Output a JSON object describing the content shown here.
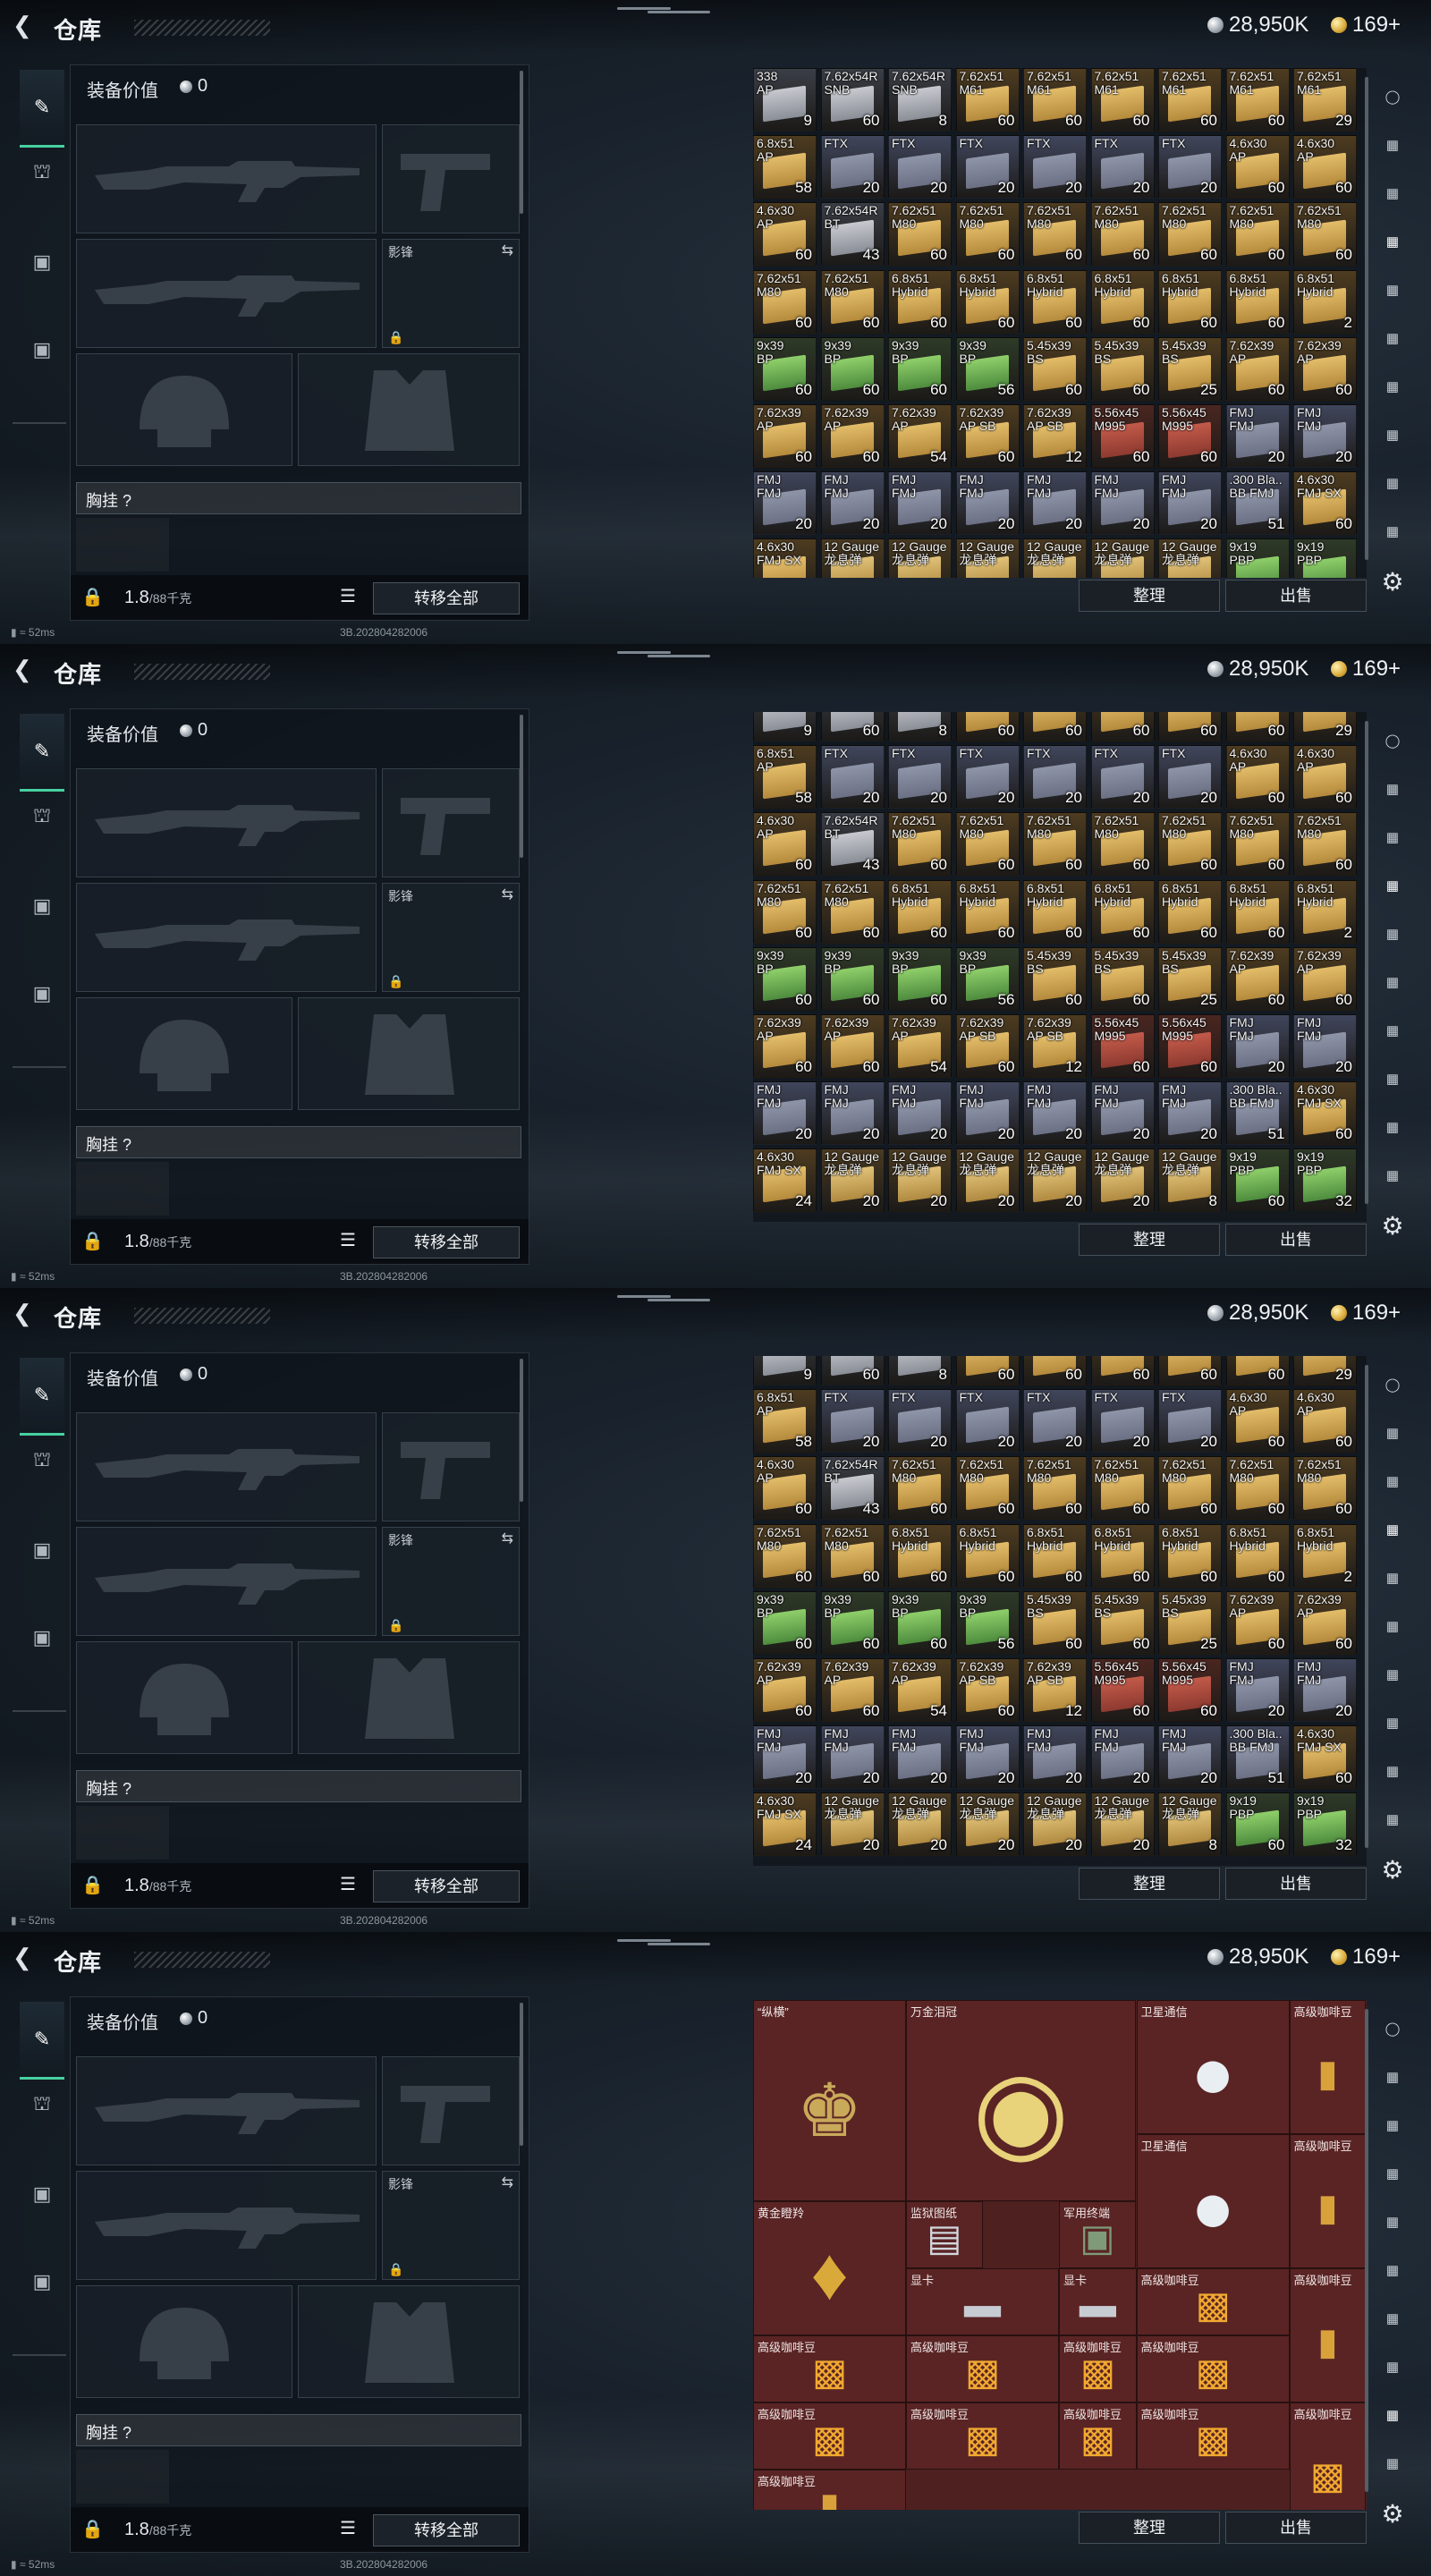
{
  "header": {
    "title": "仓库",
    "silver": "28,950K",
    "gold": "169+"
  },
  "left_tabs": [
    {
      "name": "weapons",
      "icon": "pistol-icon"
    },
    {
      "name": "helmet",
      "icon": "helmet-icon"
    },
    {
      "name": "armor",
      "icon": "vest-icon"
    },
    {
      "name": "bag",
      "icon": "briefcase-icon"
    }
  ],
  "equipment": {
    "title": "装备价值",
    "value": "0",
    "slot_label_secondary": "影锋",
    "chest_label": "胸挂 ?",
    "weight": "1.8",
    "weight_max": "/88千克",
    "transfer_all": "转移全部"
  },
  "actions": {
    "sort": "整理",
    "sell": "出售"
  },
  "status": {
    "ping": "52ms",
    "version": "3B.202804282006"
  },
  "right_bar": [
    "helmet-cat-icon",
    "gun-cat-icon",
    "ammo-cat-icon",
    "lvl-cat-icon",
    "lvl2-cat-icon",
    "lvl3-cat-icon",
    "lvl4-cat-icon",
    "lvl5-cat-icon",
    "lvl6-cat-icon",
    "lvl7-cat-icon"
  ],
  "ammo_rows": [
    [
      [
        "338\nAP",
        "9"
      ],
      [
        "7.62x54R\nSNB",
        "60"
      ],
      [
        "7.62x54R\nSNB",
        "8"
      ],
      [
        "7.62x51\nM61",
        "60"
      ],
      [
        "7.62x51\nM61",
        "60"
      ],
      [
        "7.62x51\nM61",
        "60"
      ],
      [
        "7.62x51\nM61",
        "60"
      ],
      [
        "7.62x51\nM61",
        "60"
      ],
      [
        "7.62x51\nM61",
        "29"
      ]
    ],
    [
      [
        "6.8x51\nAP",
        "58"
      ],
      [
        "FTX",
        "20"
      ],
      [
        "FTX",
        "20"
      ],
      [
        "FTX",
        "20"
      ],
      [
        "FTX",
        "20"
      ],
      [
        "FTX",
        "20"
      ],
      [
        "FTX",
        "20"
      ],
      [
        "4.6x30\nAP",
        "60"
      ],
      [
        "4.6x30\nAP",
        "60"
      ]
    ],
    [
      [
        "4.6x30\nAP",
        "60"
      ],
      [
        "7.62x54R\nBT",
        "43"
      ],
      [
        "7.62x51\nM80",
        "60"
      ],
      [
        "7.62x51\nM80",
        "60"
      ],
      [
        "7.62x51\nM80",
        "60"
      ],
      [
        "7.62x51\nM80",
        "60"
      ],
      [
        "7.62x51\nM80",
        "60"
      ],
      [
        "7.62x51\nM80",
        "60"
      ],
      [
        "7.62x51\nM80",
        "60"
      ]
    ],
    [
      [
        "7.62x51\nM80",
        "60"
      ],
      [
        "7.62x51\nM80",
        "60"
      ],
      [
        "6.8x51\nHybrid",
        "60"
      ],
      [
        "6.8x51\nHybrid",
        "60"
      ],
      [
        "6.8x51\nHybrid",
        "60"
      ],
      [
        "6.8x51\nHybrid",
        "60"
      ],
      [
        "6.8x51\nHybrid",
        "60"
      ],
      [
        "6.8x51\nHybrid",
        "60"
      ],
      [
        "6.8x51\nHybrid",
        "2"
      ]
    ],
    [
      [
        "9x39\nBP",
        "60"
      ],
      [
        "9x39\nBP",
        "60"
      ],
      [
        "9x39\nBP",
        "60"
      ],
      [
        "9x39\nBP",
        "56"
      ],
      [
        "5.45x39\nBS",
        "60"
      ],
      [
        "5.45x39\nBS",
        "60"
      ],
      [
        "5.45x39\nBS",
        "25"
      ],
      [
        "7.62x39\nAP",
        "60"
      ],
      [
        "7.62x39\nAP",
        "60"
      ]
    ],
    [
      [
        "7.62x39\nAP",
        "60"
      ],
      [
        "7.62x39\nAP",
        "60"
      ],
      [
        "7.62x39\nAP",
        "54"
      ],
      [
        "7.62x39\nAP SB",
        "60"
      ],
      [
        "7.62x39\nAP SB",
        "12"
      ],
      [
        "5.56x45\nM995",
        "60"
      ],
      [
        "5.56x45\nM995",
        "60"
      ],
      [
        "FMJ\nFMJ",
        "20"
      ],
      [
        "FMJ\nFMJ",
        "20"
      ]
    ],
    [
      [
        "FMJ\nFMJ",
        "20"
      ],
      [
        "FMJ\nFMJ",
        "20"
      ],
      [
        "FMJ\nFMJ",
        "20"
      ],
      [
        "FMJ\nFMJ",
        "20"
      ],
      [
        "FMJ\nFMJ",
        "20"
      ],
      [
        "FMJ\nFMJ",
        "20"
      ],
      [
        "FMJ\nFMJ",
        "20"
      ],
      [
        ".300 Bla..\nBB FMJ",
        "51"
      ],
      [
        "4.6x30\nFMJ SX",
        "60"
      ]
    ],
    [
      [
        "4.6x30\nFMJ SX",
        "24"
      ],
      [
        "12 Gauge\n龙息弹",
        "20"
      ],
      [
        "12 Gauge\n龙息弹",
        "20"
      ],
      [
        "12 Gauge\n龙息弹",
        "20"
      ],
      [
        "12 Gauge\n龙息弹",
        "20"
      ],
      [
        "12 Gauge\n龙息弹",
        "20"
      ],
      [
        "12 Gauge\n龙息弹",
        "8"
      ],
      [
        "9x19\nPBP",
        "60"
      ],
      [
        "9x19\nPBP",
        "32"
      ]
    ]
  ],
  "valuables": [
    {
      "name": "“纵横”",
      "icon": "chess-set-icon"
    },
    {
      "name": "万金泪冠",
      "icon": "jeweled-egg-icon"
    },
    {
      "name": "卫星通信",
      "icon": "satellite-dish-icon"
    },
    {
      "name": "高级咖啡豆",
      "icon": "coffee-bag-icon"
    },
    {
      "name": "卫星通信",
      "icon": "satellite-dish-icon"
    },
    {
      "name": "高级咖啡豆",
      "icon": "coffee-bag-icon"
    },
    {
      "name": "黄金瞪羚",
      "icon": "gold-gazelle-icon"
    },
    {
      "name": "监狱图纸",
      "icon": "blueprint-icon"
    },
    {
      "name": "军用终端",
      "icon": "terminal-icon"
    },
    {
      "name": "显卡",
      "icon": "gpu-icon"
    },
    {
      "name": "显卡",
      "icon": "gpu-icon"
    },
    {
      "name": "高级咖啡豆",
      "icon": "coffee-tin-icon"
    },
    {
      "name": "高级咖啡豆",
      "icon": "coffee-bag-icon"
    },
    {
      "name": "高级咖啡豆",
      "icon": "coffee-tin-icon"
    },
    {
      "name": "高级咖啡豆",
      "icon": "coffee-tin-icon"
    },
    {
      "name": "高级咖啡豆",
      "icon": "coffee-tin-icon"
    },
    {
      "name": "高级咖啡豆",
      "icon": "coffee-tin-icon"
    },
    {
      "name": "高级咖啡豆",
      "icon": "coffee-tin-icon"
    },
    {
      "name": "高级咖啡豆",
      "icon": "coffee-tin-icon"
    },
    {
      "name": "高级咖啡豆",
      "icon": "coffee-tin-icon"
    },
    {
      "name": "高级咖啡豆",
      "icon": "coffee-tin-icon"
    },
    {
      "name": "高级咖啡豆",
      "icon": "coffee-tin-icon"
    },
    {
      "name": "高级咖啡豆",
      "icon": "coffee-bag-icon"
    }
  ]
}
